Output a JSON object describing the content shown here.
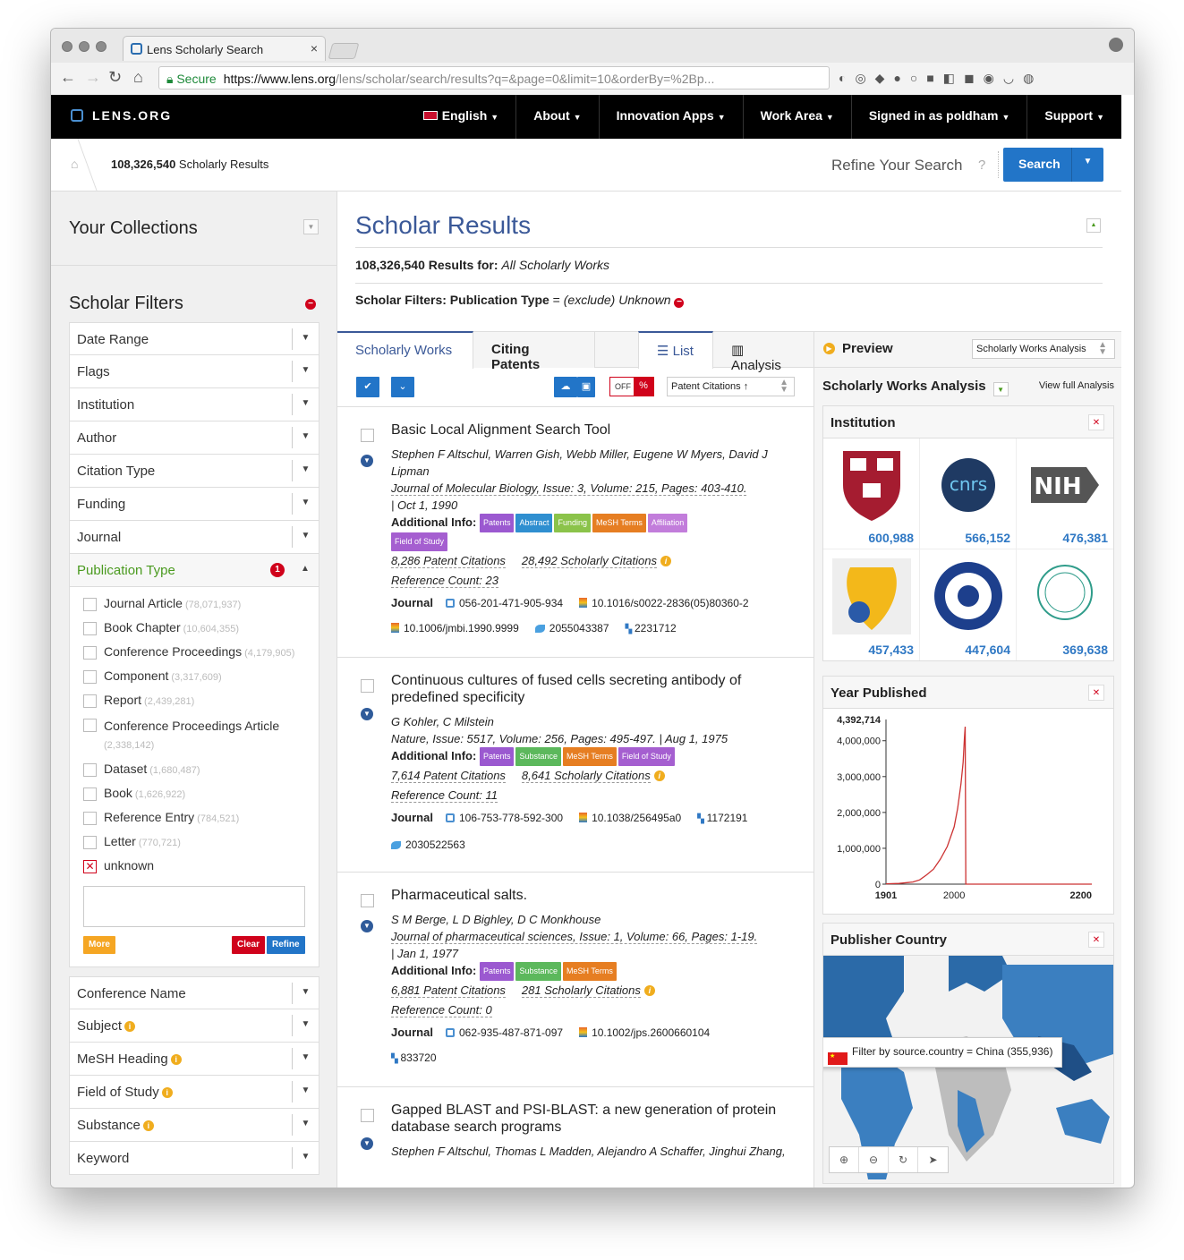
{
  "browser": {
    "tab_title": "Lens Scholarly Search",
    "secure_label": "Secure",
    "url_host": "https://www.lens.org",
    "url_path": "/lens/scholar/search/results?q=&page=0&limit=10&orderBy=%2Bp..."
  },
  "topnav": {
    "logo": "LENS.ORG",
    "items": [
      {
        "label": "English"
      },
      {
        "label": "About"
      },
      {
        "label": "Innovation Apps"
      },
      {
        "label": "Work Area"
      },
      {
        "label": "Signed in as poldham"
      },
      {
        "label": "Support"
      }
    ]
  },
  "crumb": {
    "count": "108,326,540",
    "label": "Scholarly Results",
    "refine": "Refine Your Search",
    "help": "?",
    "search_button": "Search"
  },
  "left": {
    "collections_title": "Your Collections",
    "filters_title": "Scholar Filters",
    "filters_top": [
      "Date Range",
      "Flags",
      "Institution",
      "Author",
      "Citation Type",
      "Funding",
      "Journal"
    ],
    "active_filter": "Publication Type",
    "active_badge": "1",
    "pub_types": [
      {
        "label": "Journal Article",
        "count": "(78,071,937)"
      },
      {
        "label": "Book Chapter",
        "count": "(10,604,355)"
      },
      {
        "label": "Conference Proceedings",
        "count": "(4,179,905)"
      },
      {
        "label": "Component",
        "count": "(3,317,609)"
      },
      {
        "label": "Report",
        "count": "(2,439,281)"
      },
      {
        "label": "Conference Proceedings Article",
        "count": "(2,338,142)"
      },
      {
        "label": "Dataset",
        "count": "(1,680,487)"
      },
      {
        "label": "Book",
        "count": "(1,626,922)"
      },
      {
        "label": "Reference Entry",
        "count": "(784,521)"
      },
      {
        "label": "Letter",
        "count": "(770,721)"
      },
      {
        "label": "unknown",
        "count": ""
      }
    ],
    "more_btn": "More",
    "clear_btn": "Clear",
    "refine_btn": "Refine",
    "filters_bottom": [
      {
        "label": "Conference Name",
        "info": false
      },
      {
        "label": "Subject",
        "info": true
      },
      {
        "label": "MeSH Heading",
        "info": true
      },
      {
        "label": "Field of Study",
        "info": true
      },
      {
        "label": "Substance",
        "info": true
      },
      {
        "label": "Keyword",
        "info": false
      }
    ]
  },
  "main": {
    "title": "Scholar Results",
    "results_count": "108,326,540 Results for:",
    "results_scope": "All Scholarly Works",
    "filter_label": "Scholar Filters: Publication Type",
    "filter_eq": " = ",
    "filter_value": "(exclude) Unknown",
    "tabs": [
      "Scholarly Works",
      "Citing Patents",
      "List",
      "Analysis"
    ],
    "toggle_off": "OFF",
    "sort_select": "Patent Citations ↑"
  },
  "records": [
    {
      "title": "Basic Local Alignment Search Tool",
      "authors": "Stephen F Altschul, Warren Gish, Webb Miller, Eugene W Myers, David J Lipman",
      "journal": "Journal of Molecular Biology,  Issue: 3,  Volume: 215,  Pages: 403-410.",
      "date": "|  Oct 1, 1990",
      "pills": [
        "Patents",
        "Abstract",
        "Funding",
        "MeSH Terms",
        "Affiliation",
        "Field of Study"
      ],
      "patent_cits": "8,286 Patent Citations",
      "scholarly_cits": "28,492 Scholarly Citations",
      "refcount": "Reference Count: 23",
      "ids": [
        "056-201-471-905-934",
        "10.1016/s0022-2836(05)80360-2",
        "10.1006/jmbi.1990.9999",
        "2055043387",
        "2231712"
      ]
    },
    {
      "title": "Continuous cultures of fused cells secreting antibody of predefined specificity",
      "authors": "G Kohler, C Milstein",
      "journal": "Nature,  Issue: 5517,  Volume: 256,  Pages: 495-497.",
      "date": "|  Aug 1, 1975",
      "pills": [
        "Patents",
        "Substance",
        "MeSH Terms",
        "Field of Study"
      ],
      "patent_cits": "7,614 Patent Citations",
      "scholarly_cits": "8,641 Scholarly Citations",
      "refcount": "Reference Count: 11",
      "ids": [
        "106-753-778-592-300",
        "10.1038/256495a0",
        "1172191",
        "2030522563"
      ]
    },
    {
      "title": "Pharmaceutical salts.",
      "authors": "S M Berge, L D Bighley, D C Monkhouse",
      "journal": "Journal of pharmaceutical sciences,  Issue: 1,  Volume: 66,  Pages: 1-19.",
      "date": "|  Jan 1, 1977",
      "pills": [
        "Patents",
        "Substance",
        "MeSH Terms"
      ],
      "patent_cits": "6,881 Patent Citations",
      "scholarly_cits": "281 Scholarly Citations",
      "refcount": "Reference Count: 0",
      "ids": [
        "062-935-487-871-097",
        "10.1002/jps.2600660104",
        "833720"
      ]
    },
    {
      "title": "Gapped BLAST and PSI-BLAST: a new generation of protein database search programs",
      "authors": "Stephen F Altschul, Thomas L Madden, Alejandro A Schaffer, Jinghui Zhang,"
    }
  ],
  "labels": {
    "additional_info": "Additional Info:",
    "journal": "Journal"
  },
  "side": {
    "preview": "Preview",
    "select": "Scholarly Works Analysis",
    "analysis_title": "Scholarly Works Analysis",
    "view_full": "View full Analysis",
    "institution_title": "Institution",
    "institutions": [
      "600,988",
      "566,152",
      "476,381",
      "457,433",
      "447,604",
      "369,638"
    ],
    "year_title": "Year Published",
    "publisher_title": "Publisher Country",
    "tooltip": "Filter by source.country = China (355,936)"
  },
  "chart_data": {
    "type": "line",
    "title": "Year Published",
    "x_ticks": [
      "1901",
      "2000",
      "2200"
    ],
    "y_ticks": [
      "0",
      "1,000,000",
      "2,000,000",
      "3,000,000",
      "4,000,000"
    ],
    "y_max_label": "4,392,714",
    "xlim": [
      1901,
      2200
    ],
    "ylim": [
      0,
      4392714
    ],
    "x": [
      1901,
      1920,
      1940,
      1950,
      1960,
      1970,
      1980,
      1990,
      2000,
      2005,
      2010,
      2013,
      2015,
      2016,
      2017,
      2018,
      2030,
      2100,
      2200
    ],
    "y": [
      10000,
      20000,
      60000,
      120000,
      260000,
      420000,
      700000,
      1050000,
      1600000,
      2100000,
      2800000,
      3400000,
      4100000,
      4392714,
      0,
      0,
      0,
      0,
      0
    ],
    "color": "#cc3333"
  }
}
